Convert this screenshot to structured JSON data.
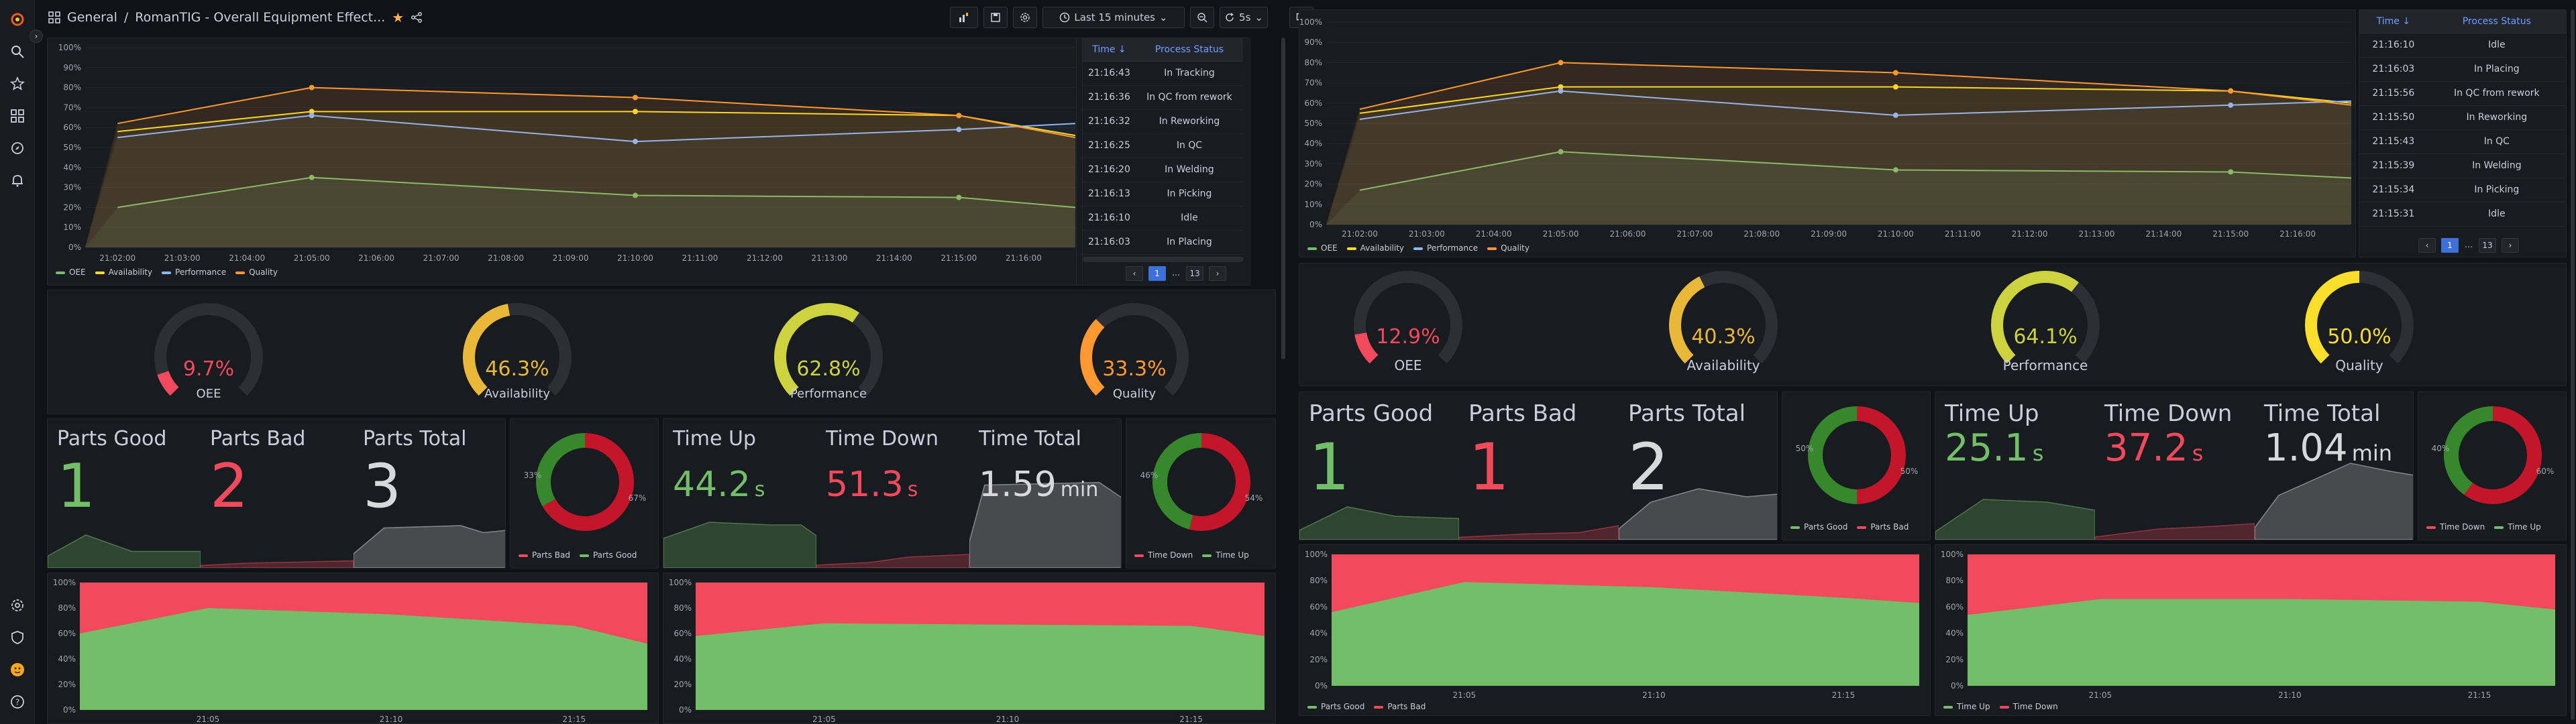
{
  "app": {
    "breadcrumb_folder": "General",
    "breadcrumb_sep": "/",
    "dashboard_title": "RomanTIG - Overall Equipment Effect...",
    "time_range": "Last 15 minutes",
    "refresh_interval": "5s",
    "icons": [
      "grafana-logo-icon",
      "search-icon",
      "star-icon",
      "dashboards-icon",
      "explore-icon",
      "alerting-icon",
      "settings-icon",
      "shield-icon",
      "user-avatar-icon",
      "help-icon",
      "share-icon",
      "add-panel-icon",
      "save-icon",
      "settings-gear-icon",
      "clock-icon",
      "zoom-out-icon",
      "refresh-icon",
      "tv-mode-icon"
    ],
    "colors": {
      "oee": "#73bf69",
      "availability": "#fade2a",
      "performance": "#8ab8ff",
      "quality": "#ff9830",
      "good": "#73bf69",
      "bad": "#f2495c",
      "red_ring": "#c4162a",
      "green_ring": "#37872d"
    }
  },
  "left": {
    "timeseries": {
      "y_ticks": [
        "100%",
        "90%",
        "80%",
        "70%",
        "60%",
        "50%",
        "40%",
        "30%",
        "20%",
        "10%",
        "0%"
      ],
      "x_ticks": [
        "21:02:00",
        "21:03:00",
        "21:04:00",
        "21:05:00",
        "21:06:00",
        "21:07:00",
        "21:08:00",
        "21:09:00",
        "21:10:00",
        "21:11:00",
        "21:12:00",
        "21:13:00",
        "21:14:00",
        "21:15:00",
        "21:16:00"
      ],
      "legend": [
        "OEE",
        "Availability",
        "Performance",
        "Quality"
      ]
    },
    "table": {
      "headers": [
        "Time ↓",
        "Process Status"
      ],
      "rows": [
        [
          "21:16:43",
          "In Tracking"
        ],
        [
          "21:16:36",
          "In QC from rework"
        ],
        [
          "21:16:32",
          "In Reworking"
        ],
        [
          "21:16:25",
          "In QC"
        ],
        [
          "21:16:20",
          "In Welding"
        ],
        [
          "21:16:13",
          "In Picking"
        ],
        [
          "21:16:10",
          "Idle"
        ],
        [
          "21:16:03",
          "In Placing"
        ]
      ],
      "pager": {
        "prev": "‹",
        "current": "1",
        "dots": "…",
        "last": "13",
        "next": "›"
      }
    },
    "gauges": [
      {
        "label": "OEE",
        "value": "9.7%",
        "pct": 9.7,
        "color": "#f2495c"
      },
      {
        "label": "Availability",
        "value": "46.3%",
        "pct": 46.3,
        "color": "#eab839"
      },
      {
        "label": "Performance",
        "value": "62.8%",
        "pct": 62.8,
        "color": "#cdd33f"
      },
      {
        "label": "Quality",
        "value": "33.3%",
        "pct": 33.3,
        "color": "#ff9830"
      }
    ],
    "parts": {
      "good_title": "Parts Good",
      "good_value": "1",
      "bad_title": "Parts Bad",
      "bad_value": "2",
      "total_title": "Parts Total",
      "total_value": "3",
      "pie_labels": [
        "33%",
        "67%"
      ],
      "pie_good_pct": 33.3,
      "legend": [
        "Parts Bad",
        "Parts Good"
      ]
    },
    "time": {
      "up_title": "Time Up",
      "up_value": "44.2",
      "up_unit": "s",
      "down_title": "Time Down",
      "down_value": "51.3",
      "down_unit": "s",
      "total_title": "Time Total",
      "total_value": "1.59",
      "total_unit": "min",
      "pie_labels": [
        "46%",
        "54%"
      ],
      "pie_up_pct": 46,
      "legend": [
        "Time Down",
        "Time Up"
      ]
    },
    "area_charts": {
      "y_ticks": [
        "100%",
        "80%",
        "60%",
        "40%",
        "20%",
        "0%"
      ],
      "x_ticks": [
        "21:05",
        "21:10",
        "21:15"
      ]
    }
  },
  "right": {
    "timeseries": {
      "y_ticks": [
        "100%",
        "90%",
        "80%",
        "70%",
        "60%",
        "50%",
        "40%",
        "30%",
        "20%",
        "10%",
        "0%"
      ],
      "x_ticks": [
        "21:02:00",
        "21:03:00",
        "21:04:00",
        "21:05:00",
        "21:06:00",
        "21:07:00",
        "21:08:00",
        "21:09:00",
        "21:10:00",
        "21:11:00",
        "21:12:00",
        "21:13:00",
        "21:14:00",
        "21:15:00",
        "21:16:00"
      ],
      "legend": [
        "OEE",
        "Availability",
        "Performance",
        "Quality"
      ]
    },
    "table": {
      "headers": [
        "Time ↓",
        "Process Status"
      ],
      "rows": [
        [
          "21:16:10",
          "Idle"
        ],
        [
          "21:16:03",
          "In Placing"
        ],
        [
          "21:15:56",
          "In QC from rework"
        ],
        [
          "21:15:50",
          "In Reworking"
        ],
        [
          "21:15:43",
          "In QC"
        ],
        [
          "21:15:39",
          "In Welding"
        ],
        [
          "21:15:34",
          "In Picking"
        ],
        [
          "21:15:31",
          "Idle"
        ]
      ],
      "pager": {
        "prev": "‹",
        "current": "1",
        "dots": "…",
        "last": "13",
        "next": "›"
      }
    },
    "gauges": [
      {
        "label": "OEE",
        "value": "12.9%",
        "pct": 12.9,
        "color": "#f2495c"
      },
      {
        "label": "Availability",
        "value": "40.3%",
        "pct": 40.3,
        "color": "#eab839"
      },
      {
        "label": "Performance",
        "value": "64.1%",
        "pct": 64.1,
        "color": "#cdd33f"
      },
      {
        "label": "Quality",
        "value": "50.0%",
        "pct": 50.0,
        "color": "#fade2a"
      }
    ],
    "parts": {
      "good_title": "Parts Good",
      "good_value": "1",
      "bad_title": "Parts Bad",
      "bad_value": "1",
      "total_title": "Parts Total",
      "total_value": "2",
      "pie_labels": [
        "50%",
        "50%"
      ],
      "pie_good_pct": 50,
      "legend": [
        "Parts Good",
        "Parts Bad"
      ]
    },
    "time": {
      "up_title": "Time Up",
      "up_value": "25.1",
      "up_unit": "s",
      "down_title": "Time Down",
      "down_value": "37.2",
      "down_unit": "s",
      "total_title": "Time Total",
      "total_value": "1.04",
      "total_unit": "min",
      "pie_labels": [
        "40%",
        "60%"
      ],
      "pie_up_pct": 40,
      "legend": [
        "Time Down",
        "Time Up"
      ]
    },
    "area_charts": {
      "y_ticks": [
        "100%",
        "80%",
        "60%",
        "40%",
        "20%",
        "0%"
      ],
      "x_ticks": [
        "21:05",
        "21:10",
        "21:15"
      ],
      "legend_parts": [
        "Parts Good",
        "Parts Bad"
      ],
      "legend_time": [
        "Time Up",
        "Time Down"
      ]
    }
  },
  "chart_data": [
    {
      "type": "line",
      "x": [
        "21:02",
        "21:05",
        "21:10",
        "21:15",
        "21:17"
      ],
      "series": [
        {
          "name": "OEE",
          "values": [
            20,
            35,
            26,
            25,
            20
          ]
        },
        {
          "name": "Availability",
          "values": [
            58,
            68,
            68,
            66,
            56
          ]
        },
        {
          "name": "Performance",
          "values": [
            55,
            66,
            53,
            59,
            62
          ]
        },
        {
          "name": "Quality",
          "values": [
            62,
            80,
            75,
            66,
            55
          ]
        }
      ],
      "ylim": [
        0,
        100
      ]
    },
    {
      "type": "line",
      "x": [
        "21:02",
        "21:05",
        "21:10",
        "21:15",
        "21:17"
      ],
      "series": [
        {
          "name": "OEE",
          "values": [
            17,
            36,
            27,
            26,
            23
          ]
        },
        {
          "name": "Availability",
          "values": [
            55,
            68,
            68,
            66,
            60
          ]
        },
        {
          "name": "Performance",
          "values": [
            52,
            66,
            54,
            59,
            61
          ]
        },
        {
          "name": "Quality",
          "values": [
            57,
            80,
            75,
            66,
            59
          ]
        }
      ],
      "ylim": [
        0,
        100
      ]
    },
    {
      "type": "area",
      "x": [
        "21:01",
        "21:05",
        "21:10",
        "21:15",
        "21:17"
      ],
      "series": [
        {
          "name": "Parts Good",
          "values": [
            60,
            80,
            75,
            66,
            52
          ]
        }
      ],
      "ylim": [
        0,
        100
      ]
    },
    {
      "type": "area",
      "x": [
        "21:01",
        "21:05",
        "21:10",
        "21:15",
        "21:17"
      ],
      "series": [
        {
          "name": "Time Up",
          "values": [
            58,
            68,
            67,
            66,
            58
          ]
        }
      ],
      "ylim": [
        0,
        100
      ]
    },
    {
      "type": "area",
      "x": [
        "21:01",
        "21:05",
        "21:10",
        "21:15",
        "21:17"
      ],
      "series": [
        {
          "name": "Parts Good",
          "values": [
            56,
            79,
            75,
            67,
            63
          ]
        }
      ],
      "ylim": [
        0,
        100
      ]
    },
    {
      "type": "area",
      "x": [
        "21:01",
        "21:05",
        "21:10",
        "21:15",
        "21:17"
      ],
      "series": [
        {
          "name": "Time Up",
          "values": [
            54,
            66,
            66,
            64,
            58
          ]
        }
      ],
      "ylim": [
        0,
        100
      ]
    }
  ]
}
